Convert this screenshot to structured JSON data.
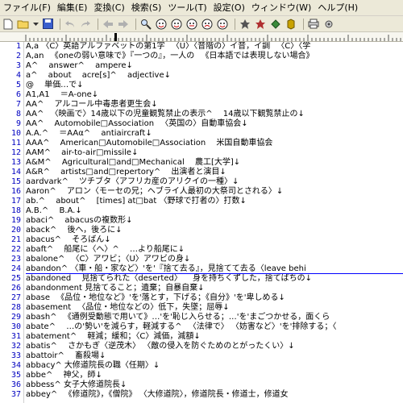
{
  "menu": [
    "ファイル(F)",
    "編集(E)",
    "変換(C)",
    "検索(S)",
    "ツール(T)",
    "設定(O)",
    "ウィンドウ(W)",
    "ヘルプ(H)"
  ],
  "toolbar_icons": [
    "new-file-icon",
    "open-folder-icon",
    "dropdown-icon",
    "save-icon",
    "undo-icon",
    "redo-icon",
    "back-icon",
    "forward-icon",
    "find-icon",
    "find-next-icon",
    "find-prev-icon",
    "replace-icon",
    "highlight-icon",
    "grep-icon",
    "tag-jump-icon",
    "compare-icon",
    "bookmark-icon",
    "sort-icon",
    "print-icon",
    "settings-icon"
  ],
  "editor": {
    "lines": [
      {
        "n": "1",
        "text": "A,a 〈C〉英語アルファベットの第1字 　〈U〉〈音階の〉イ音，イ調 　〈C〉〈学"
      },
      {
        "n": "2",
        "text": "A,an 　《oneの弱い意味で》『一つの』，一人の 　《日本語では表現しない場合》"
      },
      {
        "n": "3",
        "text": "A^ 　answer^ 　ampere↓"
      },
      {
        "n": "4",
        "text": "a^ 　about 　acre[s]^ 　adjective↓"
      },
      {
        "n": "5",
        "text": "@ 　単価…で↓"
      },
      {
        "n": "6",
        "text": "A1,A1 　＝A-one↓"
      },
      {
        "n": "7",
        "text": "AA^ 　アルコール中毒患者更生会↓"
      },
      {
        "n": "8",
        "text": "AA^ 　〈映画で〉14歳以下の児童観覧禁止の表示^ 　14歳以下観覧禁止の↓"
      },
      {
        "n": "9",
        "text": "AA^ 　Automobile□Association 　〈英国の〉自動車協会↓"
      },
      {
        "n": "10",
        "text": "A.A.^ 　＝AAα^ 　antiaircraft↓"
      },
      {
        "n": "11",
        "text": "AAA^ 　American□Automobile□Association 　米国自動車協会"
      },
      {
        "n": "12",
        "text": "AAM^ 　air-to-air□missile↓"
      },
      {
        "n": "13",
        "text": "A&M^ 　Agricultural□and□Mechanical 　農工[大学]↓"
      },
      {
        "n": "14",
        "text": "A&R^ 　artists□and□repertory^ 　出演者と演目↓"
      },
      {
        "n": "15",
        "text": "aardvark^ 　ツチブタ〈アフリカ産のアリクイの一種〉↓"
      },
      {
        "n": "16",
        "text": "Aaron^ 　アロン〈モーセの兄；ヘブライ人最初の大祭司とされる〉↓"
      },
      {
        "n": "17",
        "text": "ab.^ 　about^ 　[times] at□bat 〈野球で打者の〉打数↓"
      },
      {
        "n": "18",
        "text": "A.B.^ 　B.A.↓"
      },
      {
        "n": "19",
        "text": "abaci^ 　abacusの複数形↓"
      },
      {
        "n": "20",
        "text": "aback^ 　後へ，後ろに↓"
      },
      {
        "n": "21",
        "text": "abacus^ 　そろばん↓"
      },
      {
        "n": "22",
        "text": "abaft^ 　船尾に〈へ〉^ 　…より船尾に↓"
      },
      {
        "n": "23",
        "text": "abalone^ 　〈C〉アワビ；〈U〉アワビの身↓"
      },
      {
        "n": "24",
        "text": "abandon^ 〈車・船・家など〉'を'『捨て去る』，見捨てて去る〈leave behi"
      },
      {
        "n": "25",
        "text": "abandoned 　見捨てられた〈deserted〉 　身を持ちくずした，捨てばちの↓"
      },
      {
        "n": "26",
        "text": "abandonment 見捨てること；遺棄；自暴自棄↓"
      },
      {
        "n": "27",
        "text": "abase 　《品位・地位など》'を'落とす，下げる；《自分》'を'卑しめる↓"
      },
      {
        "n": "28",
        "text": "abasement 　〈品位・地位などの〉低下，失墜；屈辱↓"
      },
      {
        "n": "29",
        "text": "abash^ 　《通例受動態で用いて》…'を'恥じ入らせる；…'を'まごつかせる，面くら"
      },
      {
        "n": "30",
        "text": "abate^ 　…の'勢い'を減らす，軽減する^ 　〈法律で〉 〈妨害など〉'を'排除する；〈"
      },
      {
        "n": "31",
        "text": "abatement^ 　軽減；緩和；〈C〉減価，減額↓"
      },
      {
        "n": "32",
        "text": "abatis^ 　さかもぎ〈逆茂木〉 〈敵の侵入を防ぐためのとがったくい〉↓"
      },
      {
        "n": "33",
        "text": "abattoir^ 　畜殺場↓"
      },
      {
        "n": "34",
        "text": "abbacy^ 大修道院長の職〈任期〉↓"
      },
      {
        "n": "35",
        "text": "abbe^ 　神父，師↓"
      },
      {
        "n": "36",
        "text": "abbess^ 女子大修道院長↓"
      },
      {
        "n": "37",
        "text": "abbey^ 　《修道院》，《僧院》 〈大修道院〉，修道院長・修道士，修道女"
      }
    ]
  }
}
